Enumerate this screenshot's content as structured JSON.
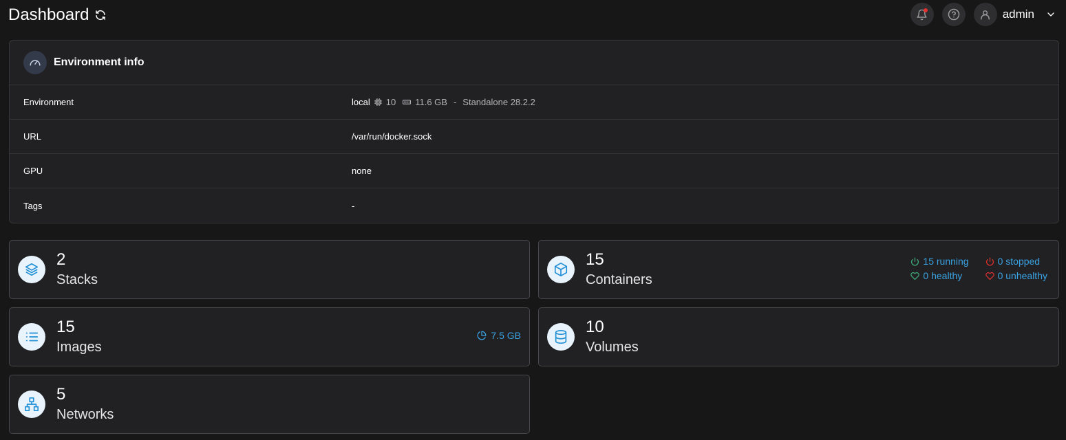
{
  "header": {
    "title": "Dashboard",
    "user": "admin"
  },
  "env_panel": {
    "title": "Environment info",
    "rows": [
      {
        "key": "Environment",
        "name": "local",
        "cpu": "10",
        "memory": "11.6 GB",
        "separator": "-",
        "type": "Standalone 28.2.2"
      },
      {
        "key": "URL",
        "value": "/var/run/docker.sock"
      },
      {
        "key": "GPU",
        "value": "none"
      },
      {
        "key": "Tags",
        "value": "-"
      }
    ]
  },
  "cards": {
    "stacks": {
      "count": "2",
      "label": "Stacks"
    },
    "containers": {
      "count": "15",
      "label": "Containers",
      "running": "15 running",
      "stopped": "0 stopped",
      "healthy": "0 healthy",
      "unhealthy": "0 unhealthy"
    },
    "images": {
      "count": "15",
      "label": "Images",
      "size": "7.5 GB"
    },
    "volumes": {
      "count": "10",
      "label": "Volumes"
    },
    "networks": {
      "count": "5",
      "label": "Networks"
    }
  },
  "colors": {
    "accent": "#3aa3e3",
    "green": "#3fb37f",
    "red": "#e5312f",
    "icon_bg": "#e8f3fb",
    "card_bg": "#212124",
    "page_bg": "#171717"
  },
  "icons": {
    "refresh": "refresh-icon",
    "bell": "bell-icon",
    "help": "help-circle-icon",
    "user": "user-icon",
    "chevron": "chevron-down-icon",
    "gauge": "gauge-icon",
    "cpu": "cpu-icon",
    "memory": "memory-icon",
    "stacks": "layers-icon",
    "containers": "box-icon",
    "images": "list-icon",
    "volumes": "database-icon",
    "networks": "network-icon",
    "power": "power-icon",
    "heart": "heart-icon",
    "pie": "pie-chart-icon"
  }
}
